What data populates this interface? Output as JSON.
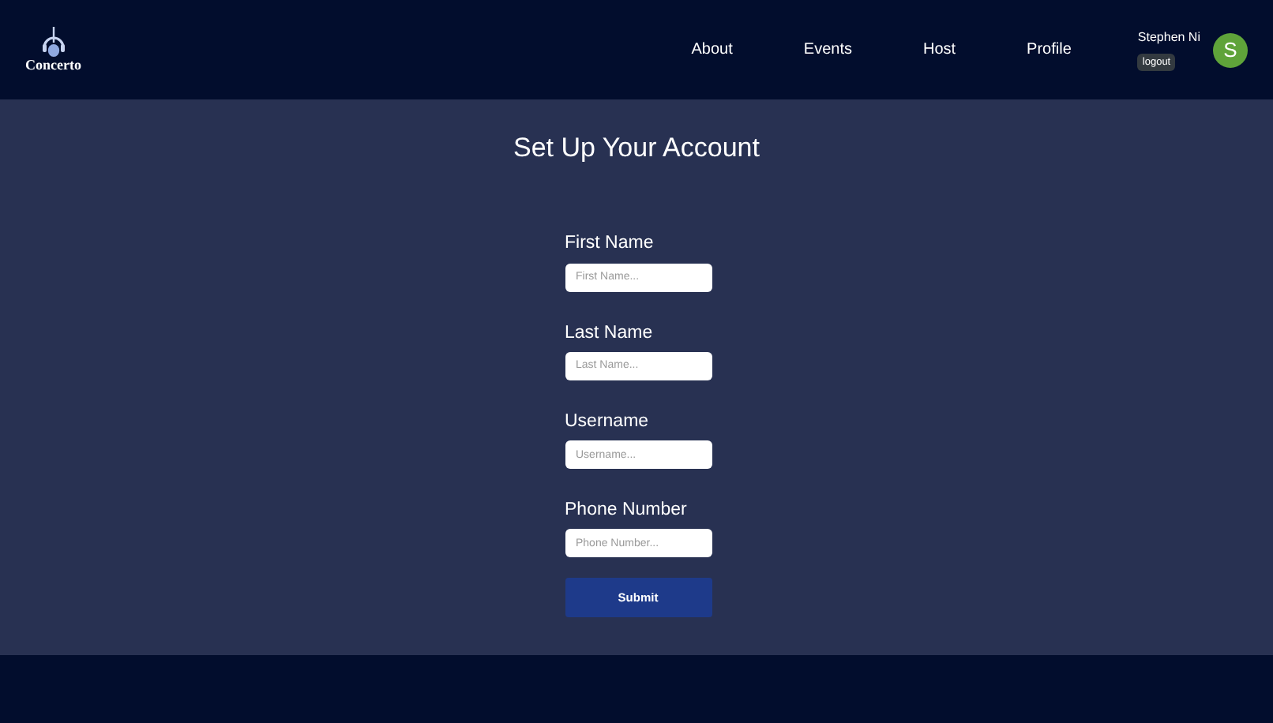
{
  "logo": {
    "text": "Concerto"
  },
  "nav": [
    {
      "label": "About"
    },
    {
      "label": "Events"
    },
    {
      "label": "Host"
    },
    {
      "label": "Profile"
    }
  ],
  "user": {
    "name": "Stephen Ni",
    "logout": "logout",
    "initial": "S"
  },
  "form": {
    "title": "Set Up Your Account",
    "fields": [
      {
        "label": "First Name",
        "placeholder": "First Name..."
      },
      {
        "label": "Last Name",
        "placeholder": "Last Name..."
      },
      {
        "label": "Username",
        "placeholder": "Username..."
      },
      {
        "label": "Phone Number",
        "placeholder": "Phone Number..."
      }
    ],
    "submit": "Submit"
  }
}
